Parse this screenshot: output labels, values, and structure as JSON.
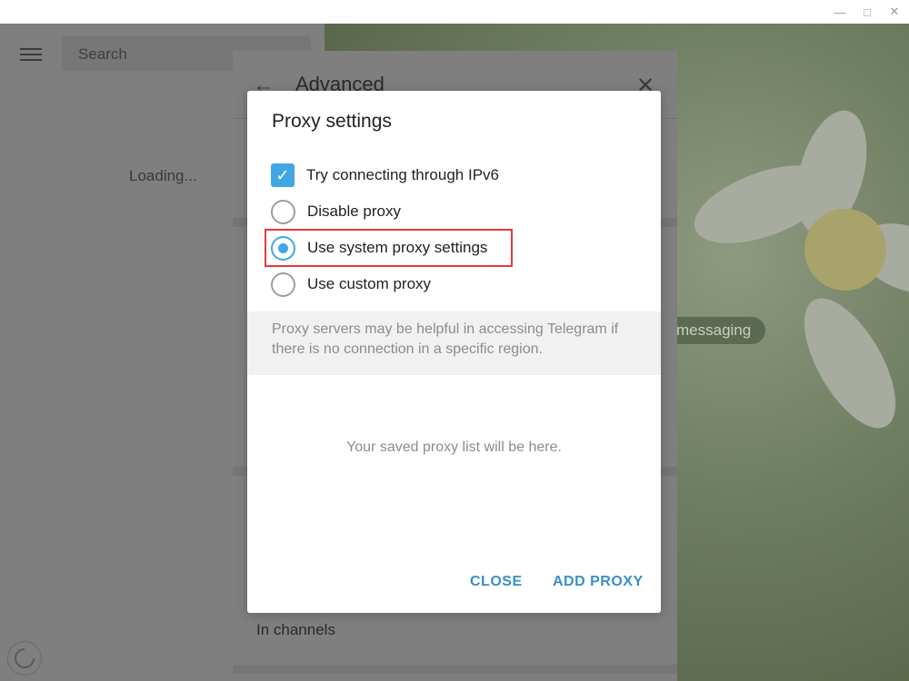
{
  "window": {
    "min_icon": "minimize-icon",
    "max_icon": "maximize-icon",
    "close_icon": "close-icon"
  },
  "sidebar": {
    "search_placeholder": "Search",
    "loading": "Loading..."
  },
  "background": {
    "badge": "messaging"
  },
  "advanced": {
    "title": "Advanced",
    "in_channels": "In channels"
  },
  "dialog": {
    "title": "Proxy settings",
    "options": [
      {
        "label": "Try connecting through IPv6",
        "type": "checkbox",
        "checked": true
      },
      {
        "label": "Disable proxy",
        "type": "radio",
        "checked": false
      },
      {
        "label": "Use system proxy settings",
        "type": "radio",
        "checked": true
      },
      {
        "label": "Use custom proxy",
        "type": "radio",
        "checked": false
      }
    ],
    "info": "Proxy servers may be helpful in accessing Telegram if there is no connection in a specific region.",
    "empty": "Your saved proxy list will be here.",
    "close_button": "CLOSE",
    "add_button": "ADD PROXY"
  },
  "colors": {
    "accent": "#40a7e3",
    "button_text": "#3a8fc9",
    "highlight": "#e5393b",
    "overlay": "#7f7f7f"
  }
}
